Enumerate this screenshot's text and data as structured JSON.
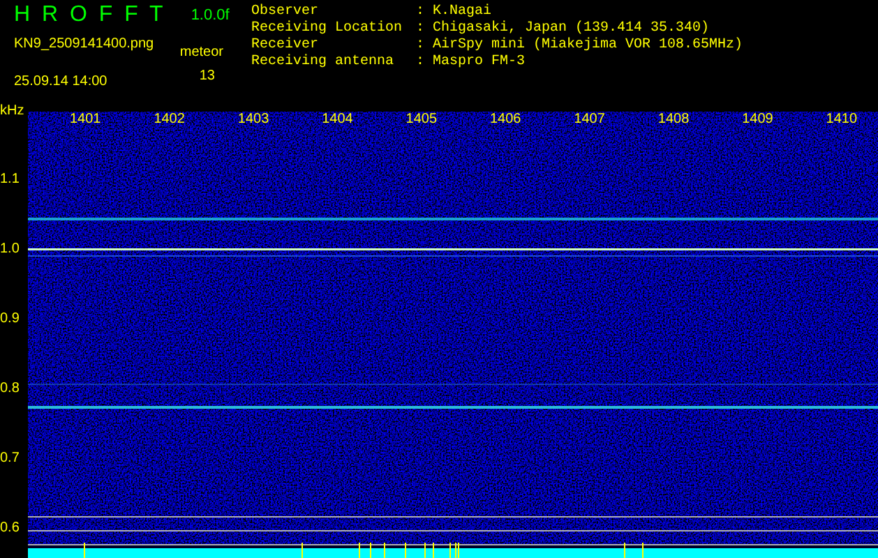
{
  "header": {
    "title": "H R O F F T",
    "version": "1.0.0f",
    "filename": "KN9_2509141400.png",
    "datetime": "25.09.14 14:00",
    "meteor_label": "meteor",
    "meteor_count": "13"
  },
  "info": [
    {
      "label": "Observer",
      "separator": ":",
      "value": "K.Nagai"
    },
    {
      "label": "Receiving Location",
      "separator": ":",
      "value": "Chigasaki, Japan (139.414 35.340)"
    },
    {
      "label": "Receiver",
      "separator": ":",
      "value": "AirSpy mini (Miakejima VOR 108.65MHz)"
    },
    {
      "label": "Receiving antenna",
      "separator": ":",
      "value": "Maspro FM-3"
    }
  ],
  "spectrogram": {
    "y_unit": "kHz",
    "x_ticks": [
      "1401",
      "1402",
      "1403",
      "1404",
      "1405",
      "1406",
      "1407",
      "1408",
      "1409",
      "1410"
    ],
    "y_ticks": [
      "1.1",
      "1.0",
      "0.9",
      "0.8",
      "0.7",
      "0.6"
    ]
  }
}
